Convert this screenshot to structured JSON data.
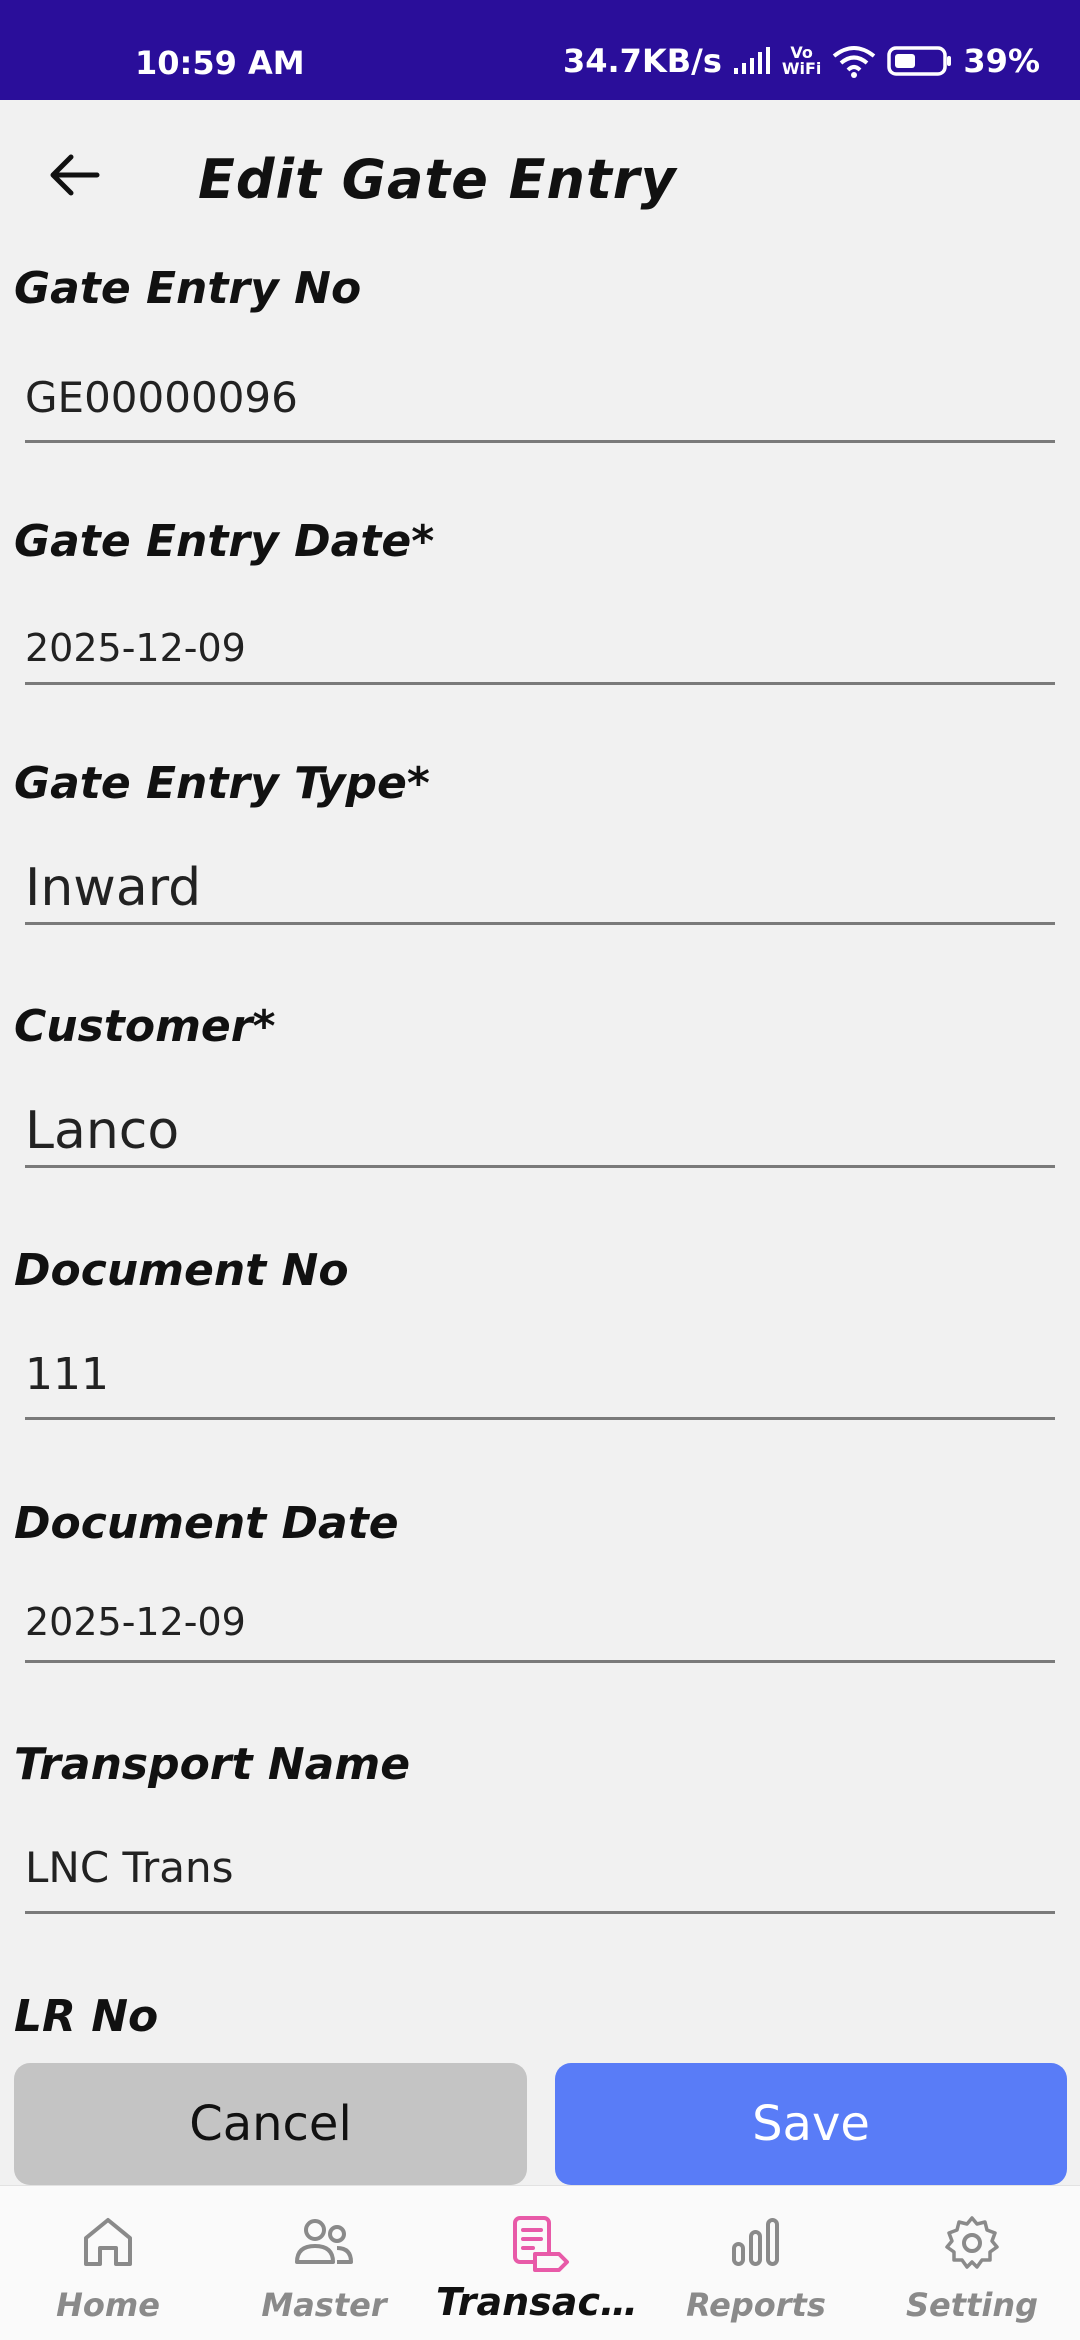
{
  "status_bar": {
    "time": "10:59 AM",
    "net_speed": "34.7KB/s",
    "vowifi_top": "Vo",
    "vowifi_bottom": "WiFi",
    "battery": "39%"
  },
  "header": {
    "title": "Edit Gate Entry",
    "back_icon": "arrow-left-icon"
  },
  "form": {
    "fields": [
      {
        "label": "Gate Entry No",
        "value": "GE00000096"
      },
      {
        "label": "Gate Entry Date*",
        "value": "2025-12-09"
      },
      {
        "label": "Gate Entry Type*",
        "value": "Inward"
      },
      {
        "label": "Customer*",
        "value": "Lanco"
      },
      {
        "label": "Document No",
        "value": "111"
      },
      {
        "label": "Document Date",
        "value": "2025-12-09"
      },
      {
        "label": "Transport Name",
        "value": "LNC Trans"
      },
      {
        "label": "LR No",
        "value": ""
      }
    ]
  },
  "actions": {
    "cancel_label": "Cancel",
    "save_label": "Save"
  },
  "bottom_nav": {
    "items": [
      {
        "label": "Home",
        "icon": "home-icon"
      },
      {
        "label": "Master",
        "icon": "users-icon"
      },
      {
        "label": "Transactio...",
        "icon": "transaction-icon",
        "active": true
      },
      {
        "label": "Reports",
        "icon": "bar-chart-icon"
      },
      {
        "label": "Setting",
        "icon": "gear-icon"
      }
    ]
  },
  "colors": {
    "status_bar": "#2a0e9a",
    "save_button": "#597cf7",
    "cancel_button": "#c4c4c4",
    "active_nav_icon": "#e85aa8",
    "background": "#f1f1f1"
  }
}
